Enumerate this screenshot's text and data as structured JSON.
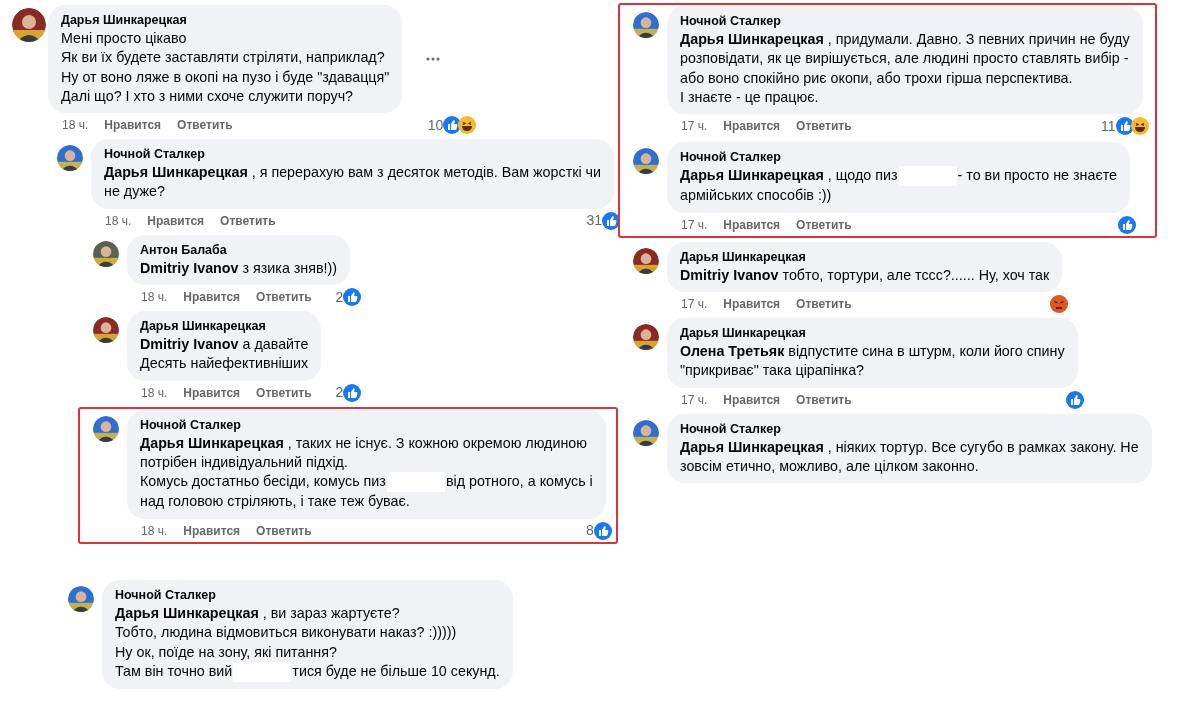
{
  "panels": [
    {
      "comments": [
        {
          "kind": "comment",
          "author": "Дарья Шинкарецкая",
          "color": "#8a2a22",
          "body": [
            "Мені просто цікаво",
            "Як ви їх будете заставляти стріляти, наприклад?",
            "Ну от воно ляже в окопі на пузо і буде \"здавацця\"",
            "Далі що? І хто з ними схоче служити поруч?"
          ],
          "time": "18 ч.",
          "like": "Нравится",
          "reply": "Ответить",
          "reaction_count": "10",
          "reactions": [
            {
              "kind": "like"
            },
            {
              "kind": "haha"
            }
          ],
          "more_button": true,
          "children": [
            {
              "kind": "comment",
              "author": "Ночной Сталкер",
              "color": "#2f6fd0",
              "body": [
                "**Дарья Шинкарецкая** , я перерахую вам з десяток методів. Вам жорсткі чи",
                "не дуже?"
              ],
              "time": "18 ч.",
              "like": "Нравится",
              "reply": "Ответить",
              "reaction_count": "31",
              "reactions": [
                {
                  "kind": "like"
                }
              ],
              "children": [
                {
                  "kind": "comment",
                  "author": "Антон Балаба",
                  "color": "#5b6150",
                  "body": [
                    "**Dmitriy Ivanov** з язика зняв!))"
                  ],
                  "time": "18 ч.",
                  "like": "Нравится",
                  "reply": "Ответить",
                  "reaction_count": "2",
                  "reactions": [
                    {
                      "kind": "like"
                    }
                  ]
                },
                {
                  "kind": "comment",
                  "author": "Дарья Шинкарецкая",
                  "color": "#8a2a22",
                  "body": [
                    "**Dmitriy Ivanov** а давайте",
                    "Десять найефективніших"
                  ],
                  "time": "18 ч.",
                  "like": "Нравится",
                  "reply": "Ответить",
                  "reaction_count": "2",
                  "reactions": [
                    {
                      "kind": "like"
                    }
                  ]
                },
                {
                  "kind": "highlight_group",
                  "comments": [
                    {
                      "kind": "comment",
                      "author": "Ночной Сталкер",
                      "color": "#2f6fd0",
                      "body": [
                        "**Дарья Шинкарецкая** , таких не існує. З кожною окремою людиною",
                        "потрібен індивідуальний підхід.",
                        [
                          "Комусь достатньо бесіди, комусь пиз",
                          "від ротного, а комусь і"
                        ],
                        "над головою стріляють, і таке теж буває."
                      ],
                      "time": "18 ч.",
                      "like": "Нравится",
                      "reply": "Ответить",
                      "reaction_count": "8",
                      "reactions": [
                        {
                          "kind": "like"
                        }
                      ]
                    }
                  ]
                }
              ]
            }
          ]
        }
      ]
    },
    {
      "comments": [
        {
          "kind": "highlight_group",
          "comments": [
            {
              "kind": "comment",
              "author": "Ночной Сталкер",
              "color": "#2f6fd0",
              "body": [
                "**Дарья Шинкарецкая** , придумали. Давно. З певних причин не буду",
                "розповідати, як це вирішується, але людині просто ставлять вибір -",
                "або воно спокійно риє окопи, або трохи гірша перспектива.",
                "І знаєте - це працює."
              ],
              "time": "17 ч.",
              "like": "Нравится",
              "reply": "Ответить",
              "reaction_count": "11",
              "reactions": [
                {
                  "kind": "like"
                },
                {
                  "kind": "haha"
                }
              ]
            },
            {
              "kind": "comment",
              "author": "Ночной Сталкер",
              "color": "#2f6fd0",
              "body": [
                [
                  "**Дарья Шинкарецкая** , щодо пиз",
                  "- то ви просто не знаєте"
                ],
                "армійських способів :))"
              ],
              "time": "17 ч.",
              "like": "Нравится",
              "reply": "Ответить",
              "reactions": [
                {
                  "kind": "like"
                }
              ]
            }
          ]
        },
        {
          "kind": "comment",
          "author": "Дарья Шинкарецкая",
          "color": "#8a2a22",
          "body": [
            "**Dmitriy Ivanov** тобто, тортури, але тссс?...... Ну, хоч так"
          ],
          "time": "17 ч.",
          "like": "Нравится",
          "reply": "Ответить",
          "reactions": [
            {
              "kind": "angry"
            }
          ]
        },
        {
          "kind": "comment",
          "author": "Дарья Шинкарецкая",
          "color": "#8a2a22",
          "body": [
            "**Олена Третьяк** відпустите сина в штурм, коли його спину",
            "\"прикриває\" така цірапінка?"
          ],
          "time": "17 ч.",
          "like": "Нравится",
          "reply": "Ответить",
          "reactions": [
            {
              "kind": "like"
            }
          ]
        },
        {
          "kind": "comment",
          "author": "Ночной Сталкер",
          "color": "#2f6fd0",
          "body": [
            "**Дарья Шинкарецкая** , ніяких тортур. Все сугубо в рамках закону. Не",
            "зовсім етично, можливо, але цілком законно."
          ]
        }
      ]
    },
    {
      "comments": [
        {
          "kind": "comment",
          "author": "Ночной Сталкер",
          "color": "#2f6fd0",
          "body": [
            "**Дарья Шинкарецкая** , ви зараз жартуєте?",
            "Тобто, людина відмовиться виконувати наказ? :)))))",
            "Ну ок, поїде на зону, які питання?",
            [
              "Там він точно вий",
              "тися буде не більше 10 секунд."
            ]
          ]
        }
      ]
    }
  ]
}
